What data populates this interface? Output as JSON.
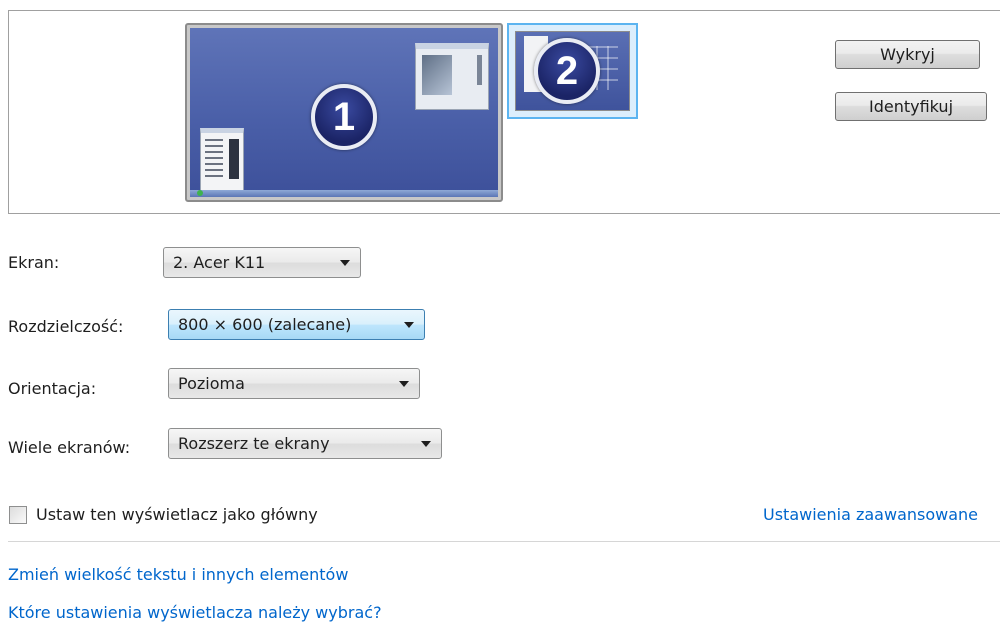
{
  "preview": {
    "monitor1_number": "1",
    "monitor2_number": "2",
    "detect_button": "Wykryj",
    "identify_button": "Identyfikuj"
  },
  "fields": {
    "screen_label": "Ekran:",
    "screen_value": "2. Acer K11",
    "resolution_label": "Rozdzielczość:",
    "resolution_value": "800 × 600 (zalecane)",
    "orientation_label": "Orientacja:",
    "orientation_value": "Pozioma",
    "multi_label": "Wiele ekranów:",
    "multi_value": "Rozszerz te ekrany"
  },
  "primary_checkbox": {
    "label": "Ustaw ten wyświetlacz jako główny",
    "checked": false
  },
  "links": {
    "advanced": "Ustawienia zaawansowane",
    "text_size": "Zmień wielkość tekstu i innych elementów",
    "which_settings": "Które ustawienia wyświetlacza należy wybrać?"
  },
  "colors": {
    "link": "#0066cc",
    "selected_monitor_border": "#5cb4f0"
  }
}
